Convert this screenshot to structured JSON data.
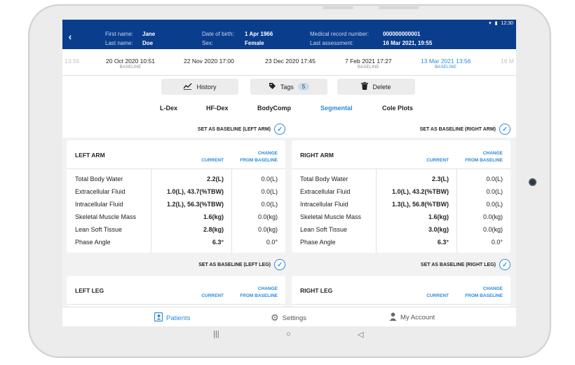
{
  "status": {
    "time": "12:30"
  },
  "header": {
    "first_name_label": "First name:",
    "first_name": "Jane",
    "last_name_label": "Last name:",
    "last_name": "Doe",
    "dob_label": "Date of birth:",
    "dob": "1 Apr 1966",
    "sex_label": "Sex:",
    "sex": "Female",
    "mrn_label": "Medical record number:",
    "mrn": "000000000001",
    "last_assessment_label": "Last assessment:",
    "last_assessment": "16 Mar 2021, 19:55"
  },
  "dates": [
    {
      "label": "13:56",
      "sub": ""
    },
    {
      "label": "20 Oct 2020 10:51",
      "sub": "BASELINE"
    },
    {
      "label": "22 Nov 2020 17:00",
      "sub": ""
    },
    {
      "label": "23 Dec 2020 17:45",
      "sub": ""
    },
    {
      "label": "7 Feb 2021 17:27",
      "sub": "BASELINE"
    },
    {
      "label": "13 Mar 2021 13:56",
      "sub": "BASELINE"
    },
    {
      "label": "16 M",
      "sub": ""
    }
  ],
  "actions": {
    "history": "History",
    "tags": "Tags",
    "tags_count": "5",
    "delete": "Delete"
  },
  "tabs": [
    "L-Dex",
    "HF-Dex",
    "BodyComp",
    "Segmental",
    "Cole Plots"
  ],
  "baseline": {
    "left_arm": "SET AS BASELINE (LEFT ARM)",
    "right_arm": "SET AS BASELINE (RIGHT ARM)",
    "left_leg": "SET AS BASELINE (LEFT LEG)",
    "right_leg": "SET AS BASELINE (RIGHT LEG)"
  },
  "columns": {
    "current": "CURRENT",
    "change_1": "CHANGE",
    "change_2": "FROM BASELINE"
  },
  "left_arm": {
    "title": "LEFT ARM",
    "rows": [
      {
        "label": "Total Body Water",
        "current": "2.2(L)",
        "change": "0.0(L)"
      },
      {
        "label": "Extracellular Fluid",
        "current": "1.0(L), 43.7(%TBW)",
        "change": "0.0(L)"
      },
      {
        "label": "Intracellular Fluid",
        "current": "1.2(L), 56.3(%TBW)",
        "change": "0.0(L)"
      },
      {
        "label": "Skeletal Muscle Mass",
        "current": "1.6(kg)",
        "change": "0.0(kg)"
      },
      {
        "label": "Lean Soft Tissue",
        "current": "2.8(kg)",
        "change": "0.0(kg)"
      },
      {
        "label": "Phase Angle",
        "current": "6.3°",
        "change": "0.0°"
      }
    ]
  },
  "right_arm": {
    "title": "RIGHT ARM",
    "rows": [
      {
        "label": "Total Body Water",
        "current": "2.3(L)",
        "change": "0.0(L)"
      },
      {
        "label": "Extracellular Fluid",
        "current": "1.0(L), 43.2(%TBW)",
        "change": "0.0(L)"
      },
      {
        "label": "Intracellular Fluid",
        "current": "1.3(L), 56.8(%TBW)",
        "change": "0.0(L)"
      },
      {
        "label": "Skeletal Muscle Mass",
        "current": "1.6(kg)",
        "change": "0.0(kg)"
      },
      {
        "label": "Lean Soft Tissue",
        "current": "3.0(kg)",
        "change": "0.0(kg)"
      },
      {
        "label": "Phase Angle",
        "current": "6.3°",
        "change": "0.0°"
      }
    ]
  },
  "left_leg": {
    "title": "LEFT LEG"
  },
  "right_leg": {
    "title": "RIGHT LEG"
  },
  "nav": {
    "patients": "Patients",
    "settings": "Settings",
    "account": "My Account"
  },
  "colors": {
    "header": "#0a3d8c",
    "accent": "#2a8ad8"
  }
}
